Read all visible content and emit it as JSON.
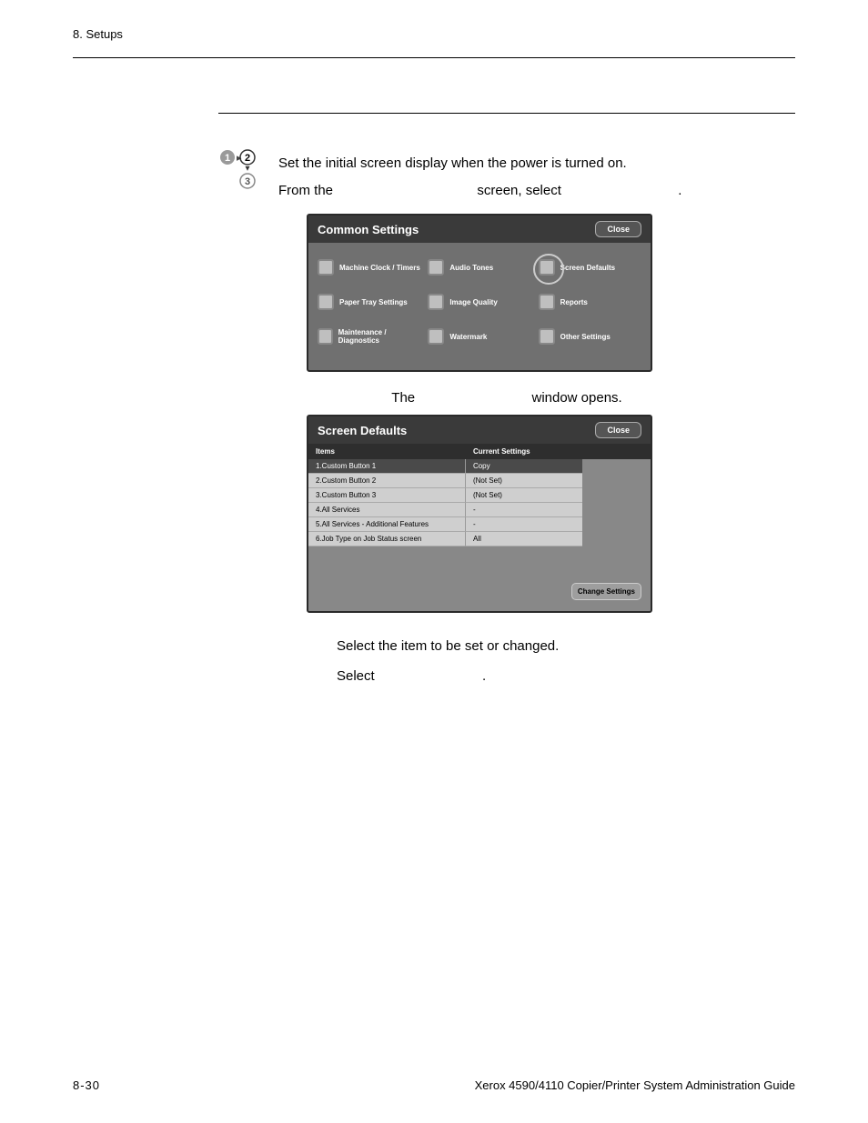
{
  "header": {
    "section": "8. Setups"
  },
  "intro": {
    "line1": "Set the initial screen display when the power is turned on.",
    "line2a": "From the",
    "line2b": "screen, select",
    "line2c": "."
  },
  "panel1": {
    "title": "Common Settings",
    "close": "Close",
    "options": [
      {
        "label": "Machine Clock / Timers"
      },
      {
        "label": "Audio Tones"
      },
      {
        "label": "Screen Defaults"
      },
      {
        "label": "Paper Tray Settings"
      },
      {
        "label": "Image Quality"
      },
      {
        "label": "Reports"
      },
      {
        "label": "Maintenance / Diagnostics"
      },
      {
        "label": "Watermark"
      },
      {
        "label": "Other Settings"
      }
    ]
  },
  "mid": {
    "a": "The",
    "b": "window opens."
  },
  "panel2": {
    "title": "Screen Defaults",
    "close": "Close",
    "hdr1": "Items",
    "hdr2": "Current Settings",
    "rows": [
      {
        "item": "1.Custom Button 1",
        "val": "Copy"
      },
      {
        "item": "2.Custom Button 2",
        "val": "(Not Set)"
      },
      {
        "item": "3.Custom Button 3",
        "val": "(Not Set)"
      },
      {
        "item": "4.All Services",
        "val": "-"
      },
      {
        "item": "5.All Services - Additional Features",
        "val": "-"
      },
      {
        "item": "6.Job Type on Job Status screen",
        "val": "All"
      }
    ],
    "change": "Change Settings"
  },
  "tail": {
    "line1": "Select the item to be set or changed.",
    "line2a": "Select",
    "line2b": "."
  },
  "footer": {
    "page": "8-30",
    "doc": "Xerox 4590/4110 Copier/Printer System Administration Guide"
  }
}
